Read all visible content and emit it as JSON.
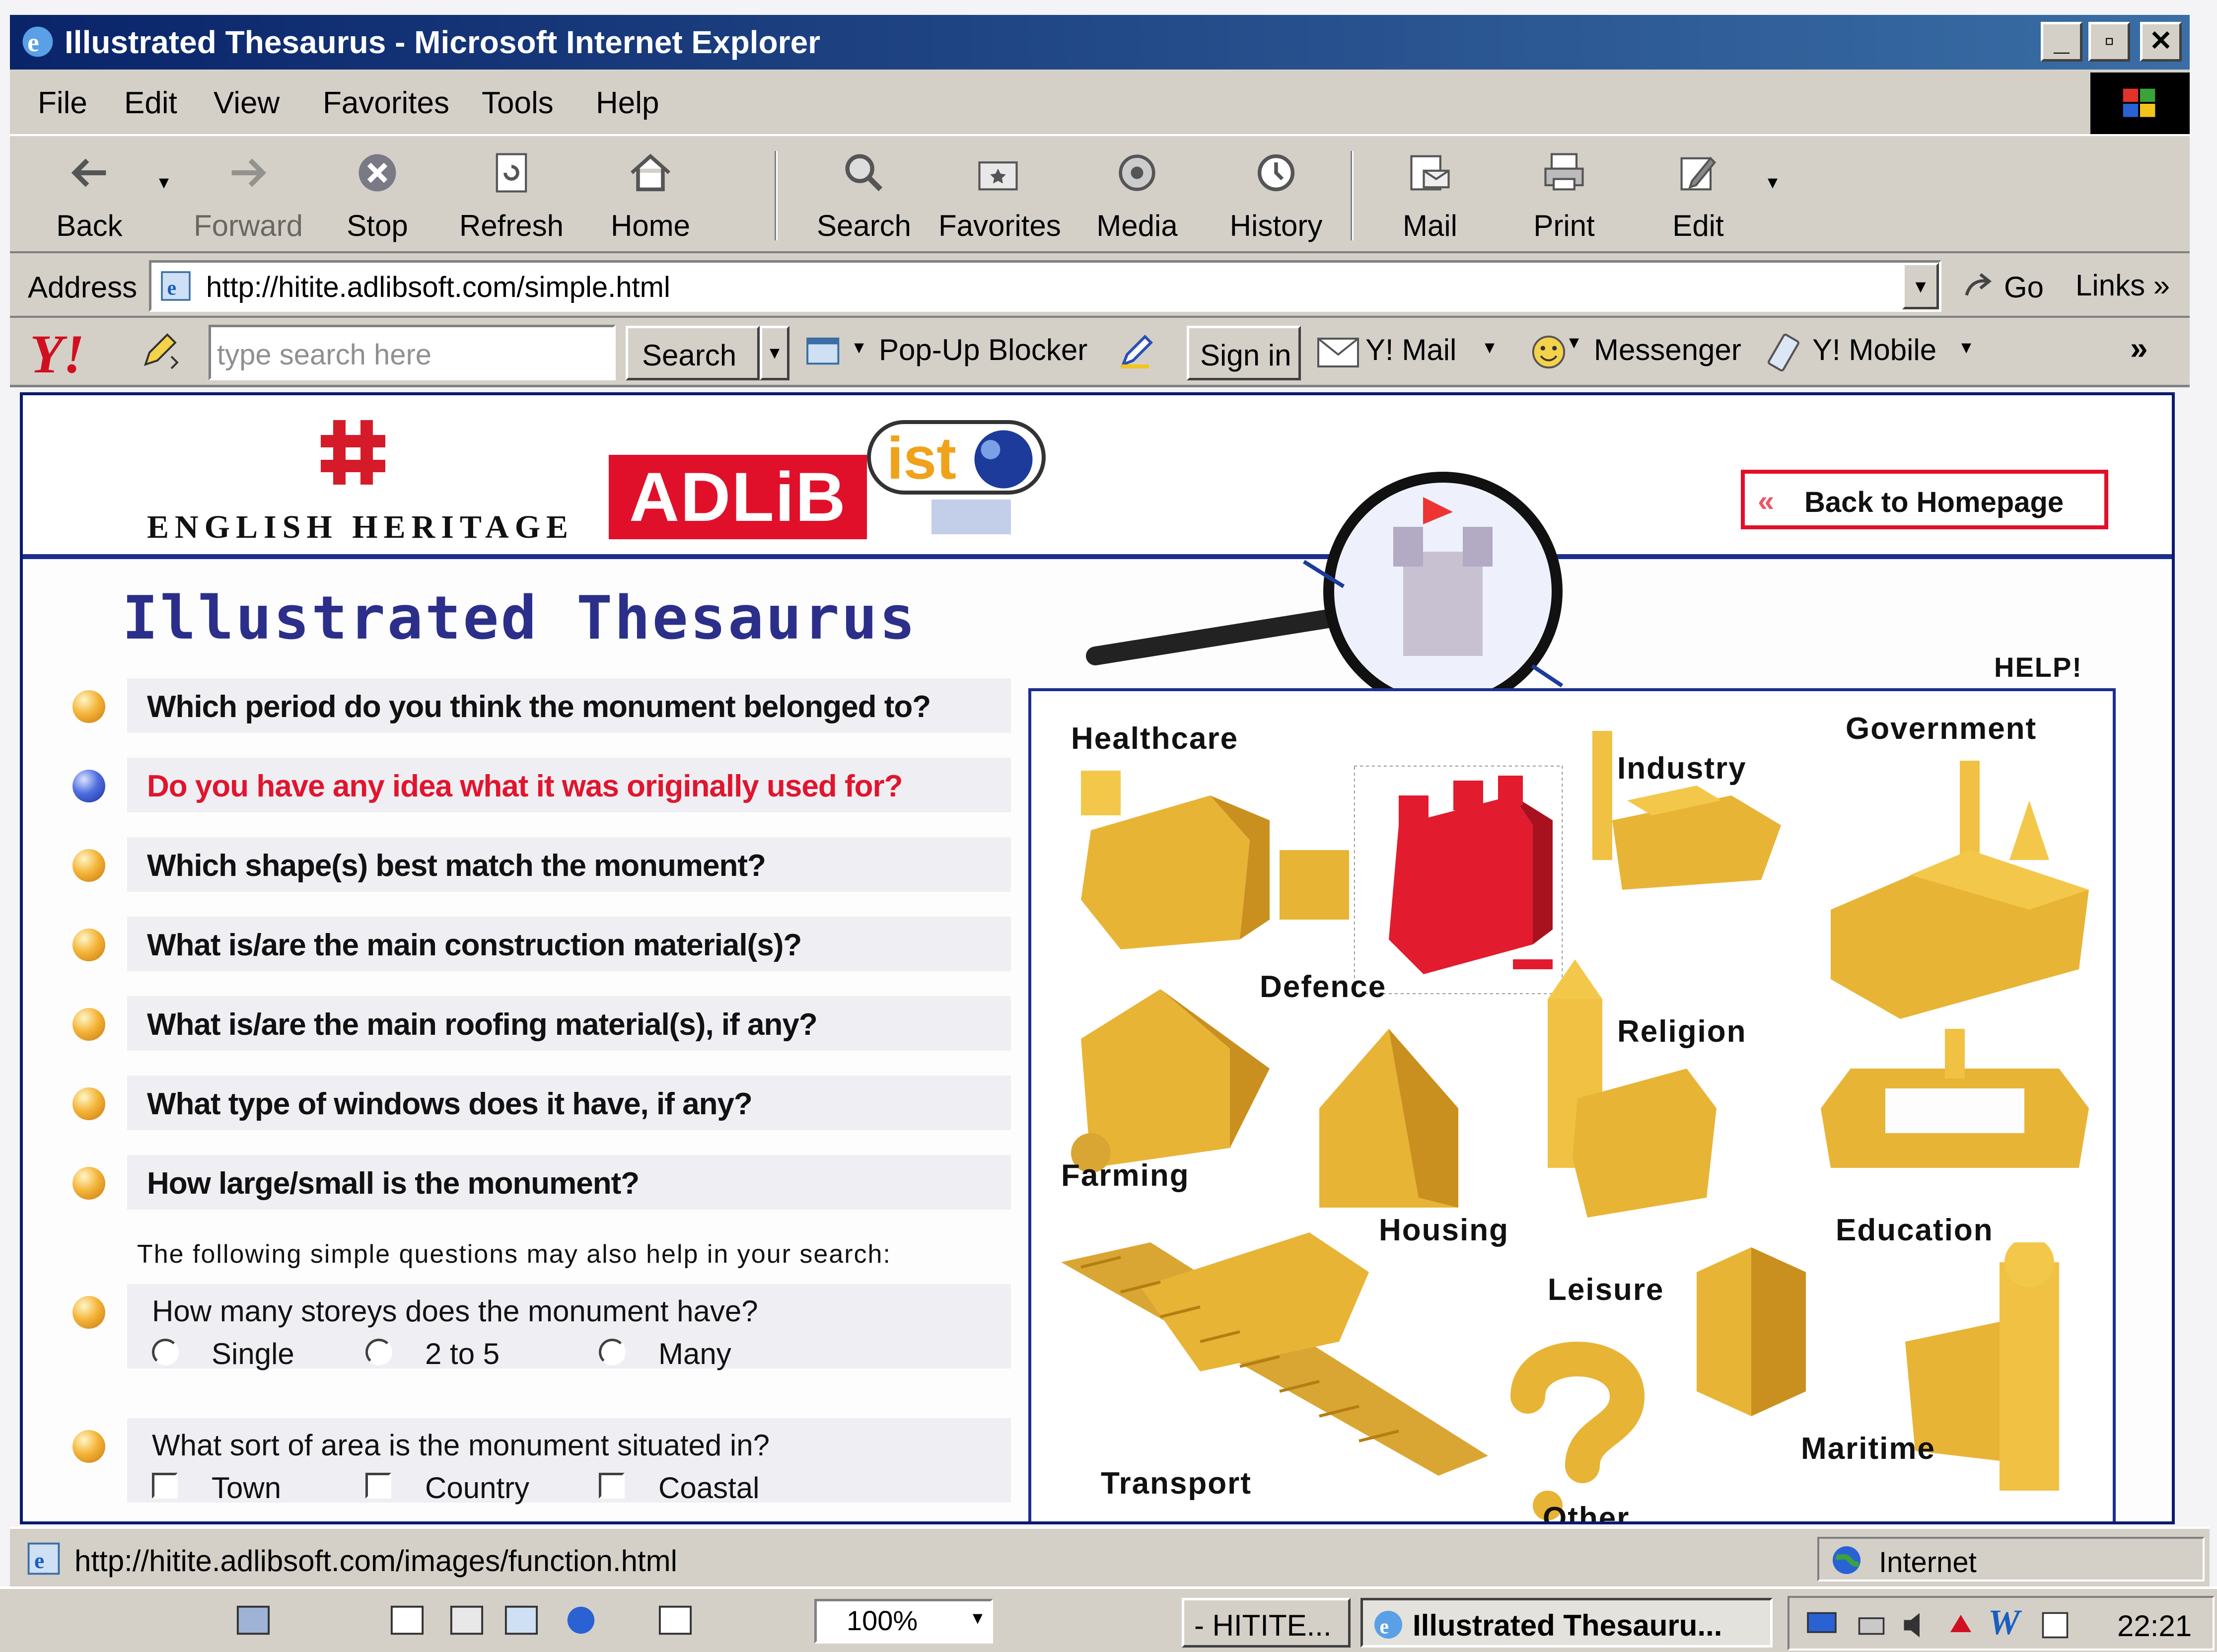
{
  "window": {
    "title": "Illustrated Thesaurus - Microsoft Internet Explorer"
  },
  "menu": [
    "File",
    "Edit",
    "View",
    "Favorites",
    "Tools",
    "Help"
  ],
  "toolbar": {
    "back": "Back",
    "forward": "Forward",
    "stop": "Stop",
    "refresh": "Refresh",
    "home": "Home",
    "search": "Search",
    "favorites": "Favorites",
    "media": "Media",
    "history": "History",
    "mail": "Mail",
    "print": "Print",
    "edit": "Edit"
  },
  "address": {
    "label": "Address",
    "url": "http://hitite.adlibsoft.com/simple.html",
    "go": "Go",
    "links": "Links"
  },
  "yahoo": {
    "logo": "Y!",
    "placeholder": "type search here",
    "search": "Search",
    "popup_blocker": "Pop-Up Blocker",
    "sign_in": "Sign in",
    "mail": "Y! Mail",
    "messenger": "Messenger",
    "mobile": "Y! Mobile"
  },
  "header": {
    "eh_text": "ENGLISH HERITAGE",
    "adlib": "ADLiB",
    "ist": "ist",
    "back_home": "Back to Homepage"
  },
  "page": {
    "title": "Illustrated Thesaurus",
    "questions": [
      "Which period do you think the monument belonged to?",
      "Do you have any idea what it was originally used for?",
      "Which shape(s) best match the monument?",
      "What is/are the main construction material(s)?",
      "What is/are the main roofing material(s), if any?",
      "What type of windows does it have, if any?",
      "How large/small is the monument?"
    ],
    "active_question": 1,
    "simple_note": "The following simple questions may also help in your search:",
    "storeys": {
      "question": "How many storeys does the monument have?",
      "options": [
        "Single",
        "2 to 5",
        "Many"
      ]
    },
    "area": {
      "question": "What sort of area is the monument situated in?",
      "options": [
        "Town",
        "Country",
        "Coastal"
      ]
    },
    "help": "HELP!",
    "functions": [
      "Healthcare",
      "Industry",
      "Government",
      "Defence",
      "Religion",
      "Farming",
      "Housing",
      "Education",
      "Leisure",
      "Transport",
      "Other",
      "Maritime"
    ]
  },
  "status": {
    "url": "http://hitite.adlibsoft.com/images/function.html",
    "zone": "Internet"
  },
  "taskbar": {
    "zoom": "100%",
    "task1": "- HITITE...",
    "task2": "Illustrated Thesauru...",
    "clock": "22:21"
  },
  "colors": {
    "active_question": "#e0152e",
    "adlib_red": "#e1102a",
    "header_blue": "#1c2f8e",
    "building_gold": "#f2c443",
    "defence_red": "#e21b2e"
  }
}
